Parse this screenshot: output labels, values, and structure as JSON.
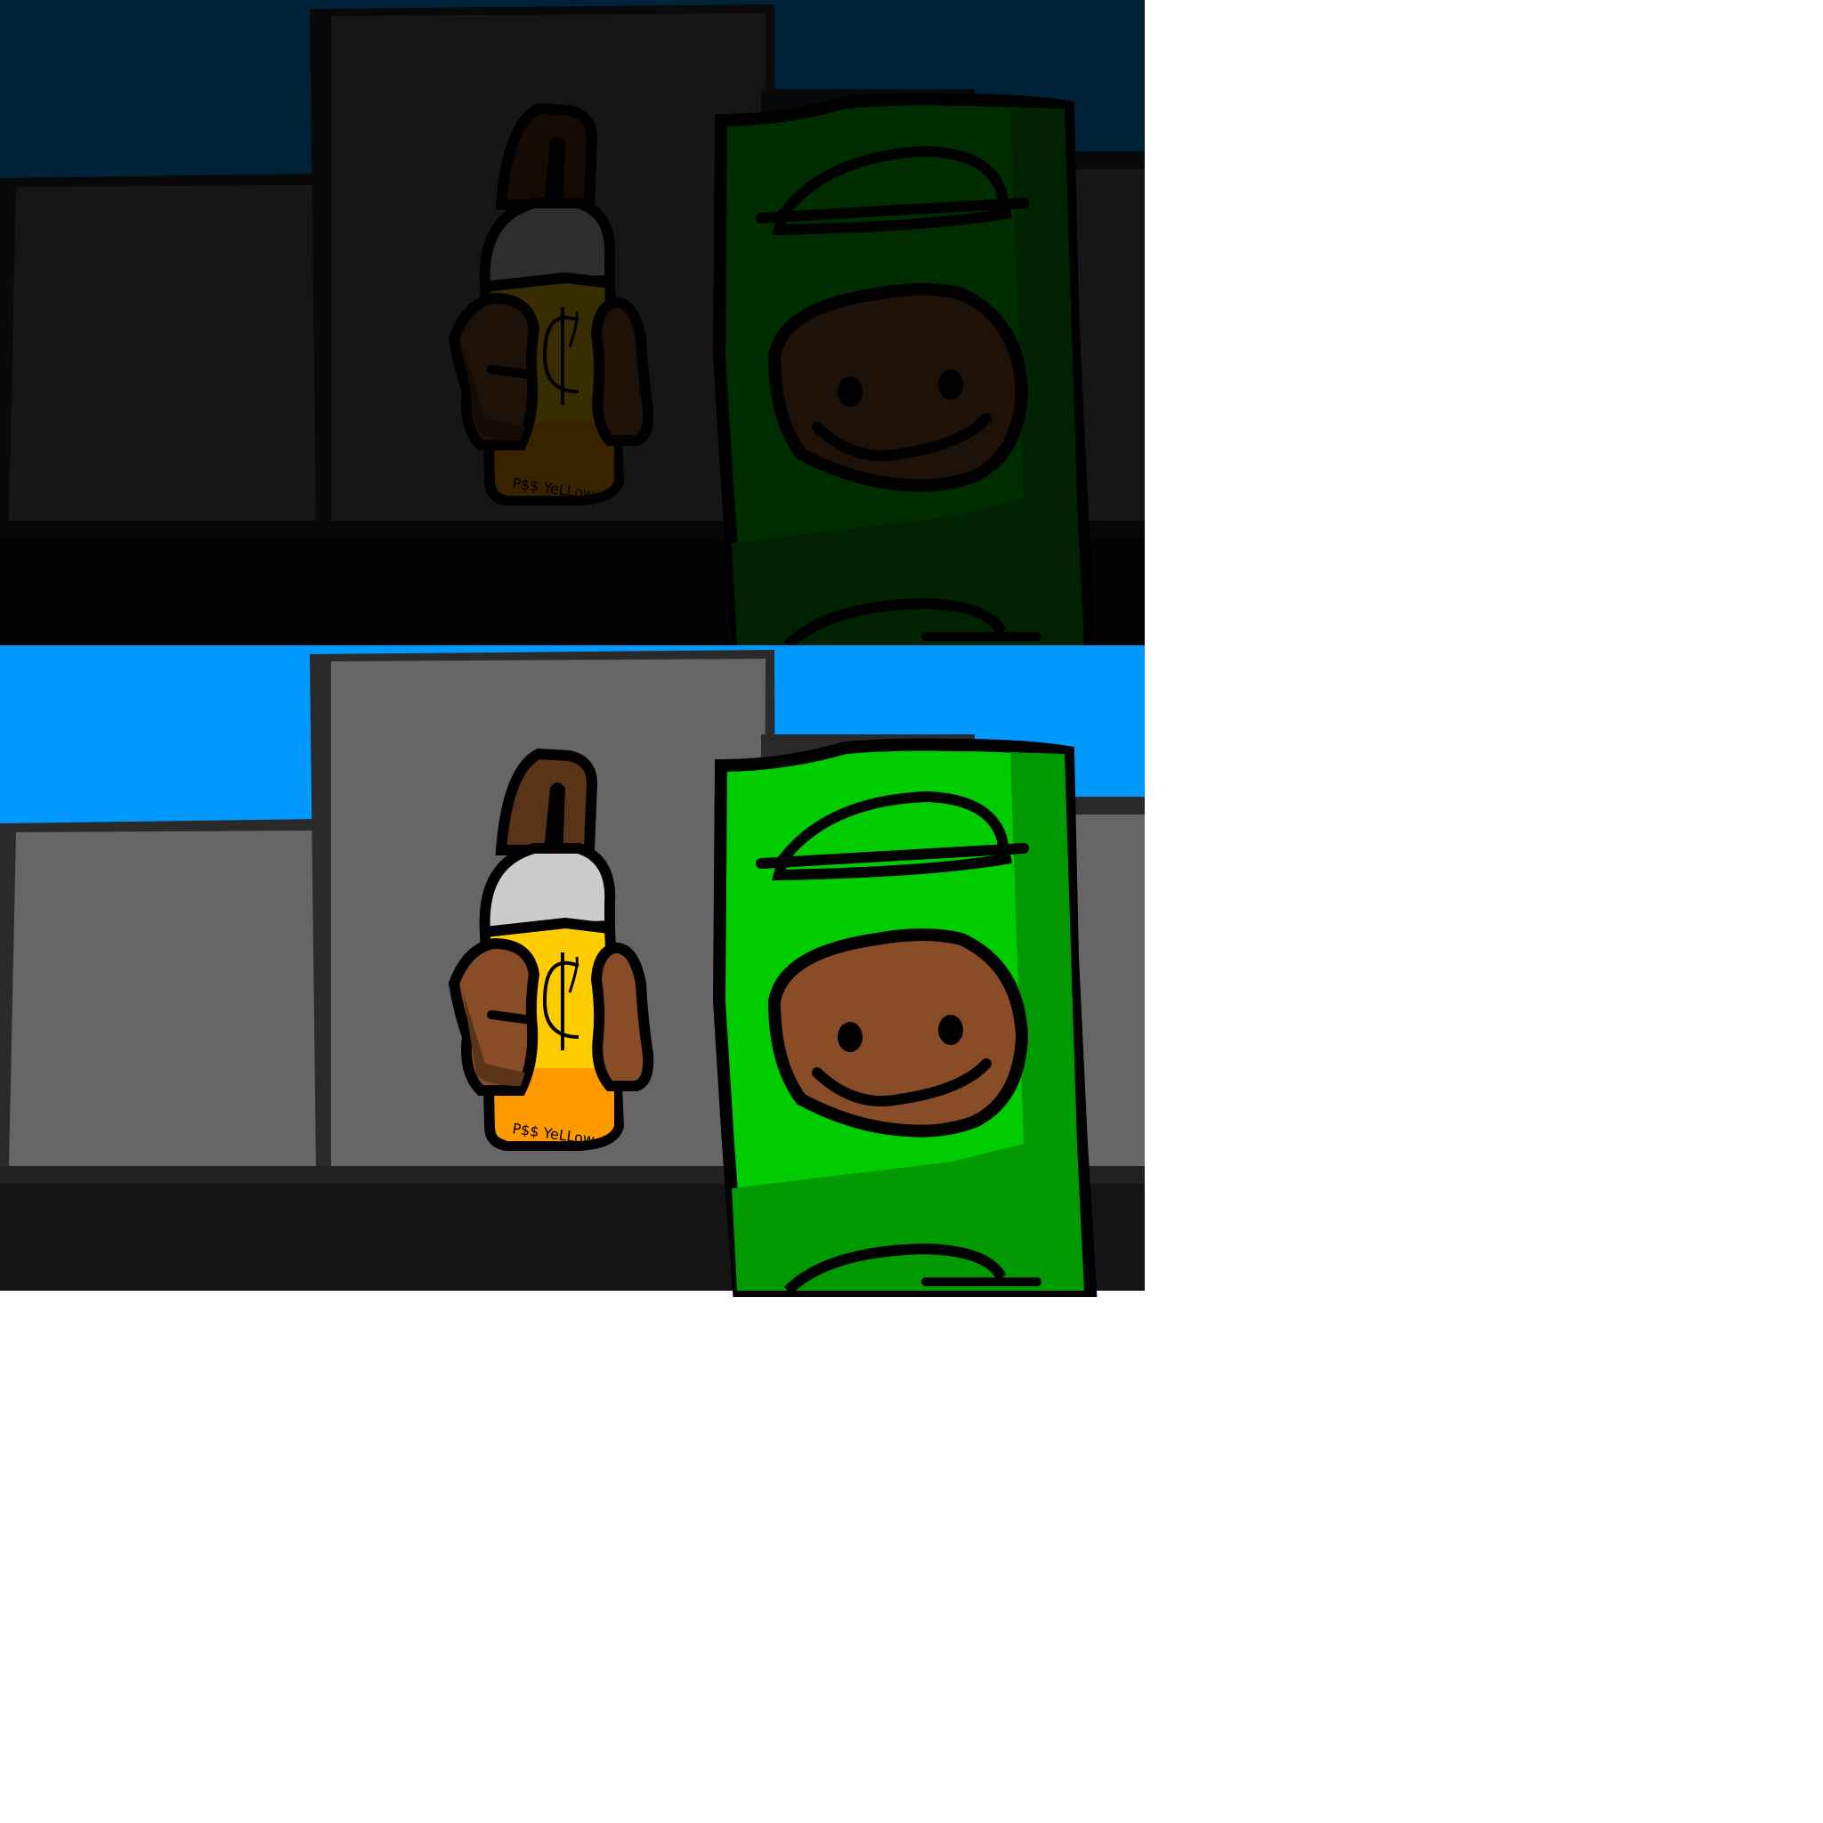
{
  "panels": [
    {
      "id": "night",
      "label_text": ""
    },
    {
      "id": "day",
      "label_text": ""
    }
  ],
  "bottle": {
    "symbol": "$",
    "label": "P$$ YeLLow"
  },
  "colors": {
    "night_sky": "#000b14",
    "day_sky": "#0099ff",
    "wall_day": "#666666",
    "wall_night": "#0a0a0a",
    "ground_day": "#141414",
    "ground_night": "#000000",
    "outline": "#000000",
    "bottle_body": "#ffcc00",
    "bottle_bottom": "#ff9900",
    "bottle_cap": "#cccccc",
    "hands": "#884d26",
    "hands_shade": "#5a3318",
    "sign_green": "#00cc00",
    "sign_dark": "#009900",
    "face": "#884d26"
  },
  "icons": [
    "bottle-character-icon",
    "smiley-face-icon",
    "dollar-sign-icon",
    "hamburger-icon"
  ]
}
